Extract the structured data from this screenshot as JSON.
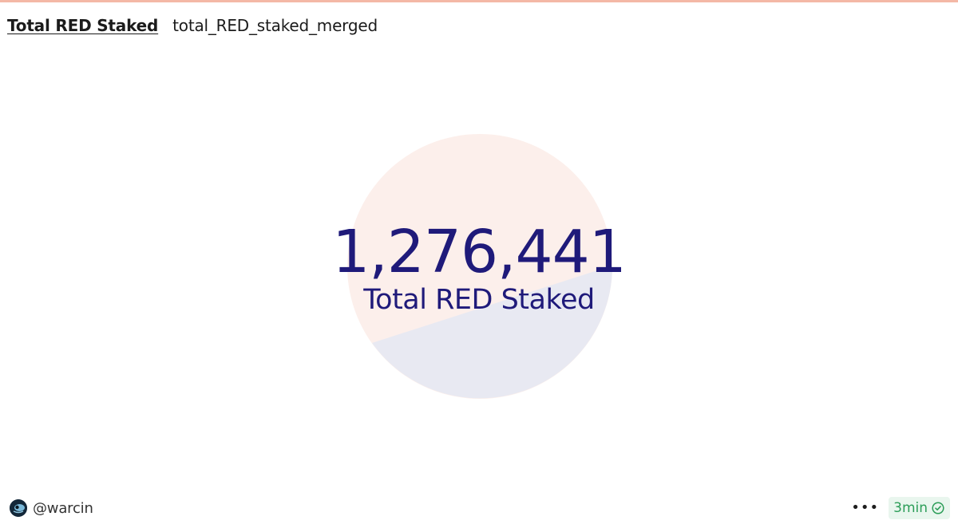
{
  "header": {
    "title": "Total RED Staked",
    "query_name": "total_RED_staked_merged"
  },
  "counter": {
    "value": "1,276,441",
    "label": "Total RED Staked"
  },
  "footer": {
    "username": "@warcin",
    "more_icon": "more-horizontal-icon",
    "freshness": "3min",
    "freshness_icon": "check-circle-icon"
  },
  "colors": {
    "accent_top": "#f4b8a6",
    "counter_text": "#1f1a7a",
    "circle_peach": "#fcefeb",
    "circle_blue": "#e8e9f2",
    "freshness_text": "#2c9d58",
    "freshness_bg": "#e9f6ee"
  }
}
